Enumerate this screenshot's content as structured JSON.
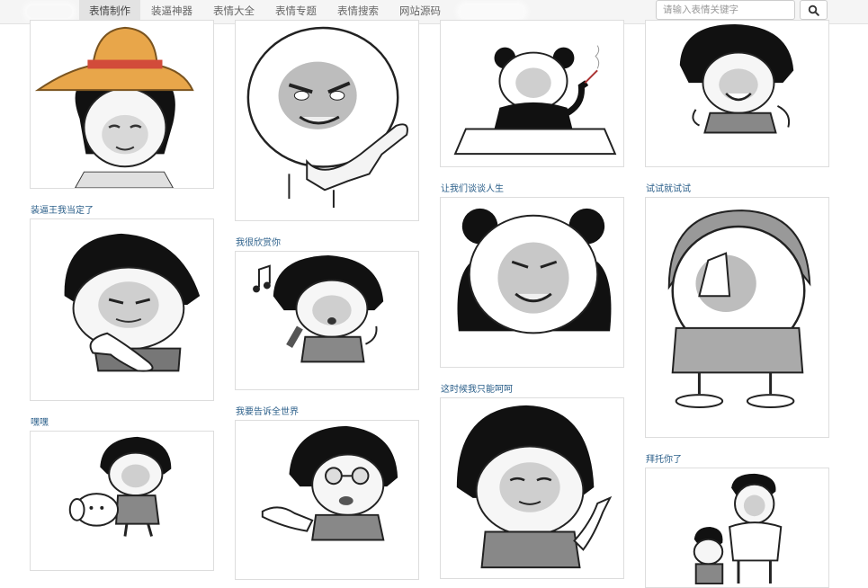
{
  "nav": {
    "items": [
      {
        "label": "表情制作",
        "active": true
      },
      {
        "label": "装逼神器",
        "active": false
      },
      {
        "label": "表情大全",
        "active": false
      },
      {
        "label": "表情专题",
        "active": false
      },
      {
        "label": "表情搜索",
        "active": false
      },
      {
        "label": "网站源码",
        "active": false
      }
    ]
  },
  "search": {
    "placeholder": "请输入表情关键字",
    "button_icon": "search-icon"
  },
  "captions": {
    "c2": "装逼王我当定了",
    "c3": "我很欣赏你",
    "c4": "让我们谈谈人生",
    "c5": "试试就试试",
    "c6": "嘿嘿",
    "c7": "我要告诉全世界",
    "c8": "这时候我只能呵呵",
    "c9": "拜托你了"
  },
  "colors": {
    "caption": "#2b5f8a",
    "nav_bg": "#f5f5f5",
    "active_tab": "#e3e3e3"
  }
}
